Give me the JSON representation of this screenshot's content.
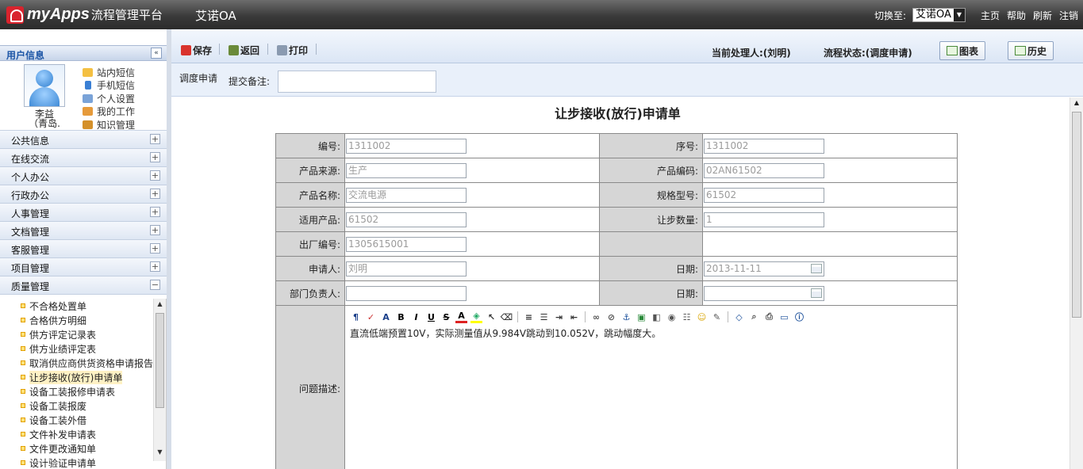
{
  "topbar": {
    "logo_text": "myApps",
    "logo_sub": "流程管理平台",
    "app_name": "艾诺OA",
    "switch_label": "切换至:",
    "switch_value": "艾诺OA",
    "links": [
      "主页",
      "帮助",
      "刷新",
      "注销"
    ]
  },
  "sidebar": {
    "user_info_title": "用户信息",
    "collapse_symbol": "«",
    "user_name": "李益",
    "user_org": "（青岛.",
    "quick_links": [
      "站内短信",
      "手机短信",
      "个人设置",
      "我的工作",
      "知识管理"
    ],
    "menu": [
      {
        "label": "公共信息",
        "toggle": "+"
      },
      {
        "label": "在线交流",
        "toggle": "+"
      },
      {
        "label": "个人办公",
        "toggle": "+"
      },
      {
        "label": "行政办公",
        "toggle": "+"
      },
      {
        "label": "人事管理",
        "toggle": "+"
      },
      {
        "label": "文档管理",
        "toggle": "+"
      },
      {
        "label": "客服管理",
        "toggle": "+"
      },
      {
        "label": "项目管理",
        "toggle": "+"
      },
      {
        "label": "质量管理",
        "toggle": "−"
      }
    ],
    "submenu": [
      "不合格处置单",
      "合格供方明细",
      "供方评定记录表",
      "供方业绩评定表",
      "取消供应商供货资格申请报告",
      "让步接收(放行)申请单",
      "设备工装报修申请表",
      "设备工装报废",
      "设备工装外借",
      "文件补发申请表",
      "文件更改通知单",
      "设计验证申请单"
    ],
    "active_submenu_index": 5
  },
  "toolbar": {
    "save": "保存",
    "back": "返回",
    "print": "打印",
    "handler": "当前处理人:(刘明)",
    "status": "流程状态:(调度申请)",
    "chart_btn": "图表",
    "history_btn": "历史"
  },
  "remark": {
    "flow_step": "调度申请",
    "label": "提交备注:",
    "value": ""
  },
  "form": {
    "title": "让步接收(放行)申请单",
    "rows": [
      {
        "l1": "编号:",
        "v1": "1311002",
        "l2": "序号:",
        "v2": "1311002"
      },
      {
        "l1": "产品来源:",
        "v1": "生产",
        "l2": "产品编码:",
        "v2": "02AN61502"
      },
      {
        "l1": "产品名称:",
        "v1": "交流电源",
        "l2": "规格型号:",
        "v2": "61502"
      },
      {
        "l1": "适用产品:",
        "v1": "61502",
        "l2": "让步数量:",
        "v2": "1"
      },
      {
        "l1": "出厂编号:",
        "v1": "1305615001",
        "l2": "",
        "v2": ""
      },
      {
        "l1": "申请人:",
        "v1": "刘明",
        "l2": "日期:",
        "v2": "2013-11-11"
      },
      {
        "l1": "部门负责人:",
        "v1": "",
        "l2": "日期:",
        "v2": ""
      }
    ],
    "problem_label": "问题描述:",
    "problem_text": "直流低端预置10V，实际测量值从9.984V跳动到10.052V，跳动幅度大。"
  },
  "editor_tools": [
    "format-icon",
    "spellcheck-icon",
    "font-icon",
    "bold-icon",
    "italic-icon",
    "underline-icon",
    "strike-icon",
    "font-color-icon",
    "bg-color-icon",
    "pointer-icon",
    "eraser-icon",
    "align-icon",
    "list-icon",
    "indent-icon",
    "outdent-icon",
    "link-icon",
    "unlink-icon",
    "anchor-icon",
    "image-icon",
    "flash-icon",
    "media-icon",
    "hr-icon",
    "smiley-icon",
    "template-icon",
    "source-icon",
    "preview-icon",
    "print-icon",
    "fullscreen-icon",
    "about-icon"
  ],
  "colors": {
    "accent": "#1d56a6",
    "topbar": "#3a3a3a",
    "label_bg": "#d6d6d6"
  }
}
